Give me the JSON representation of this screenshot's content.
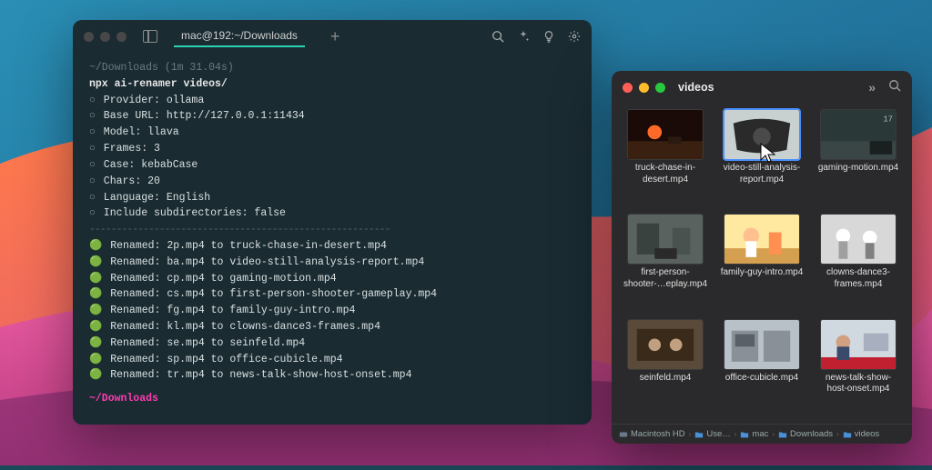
{
  "terminal": {
    "tab_title": "mac@192:~/Downloads",
    "prompt_path": "~/Downloads",
    "prompt_timing": "(1m 31.04s)",
    "command": "npx ai-renamer videos/",
    "config": [
      {
        "label": "Provider",
        "value": "ollama"
      },
      {
        "label": "Base URL",
        "value": "http://127.0.0.1:11434"
      },
      {
        "label": "Model",
        "value": "llava"
      },
      {
        "label": "Frames",
        "value": "3"
      },
      {
        "label": "Case",
        "value": "kebabCase"
      },
      {
        "label": "Chars",
        "value": "20"
      },
      {
        "label": "Language",
        "value": "English"
      },
      {
        "label": "Include subdirectories",
        "value": "false"
      }
    ],
    "renames": [
      {
        "from": "2p.mp4",
        "to": "truck-chase-in-desert.mp4"
      },
      {
        "from": "ba.mp4",
        "to": "video-still-analysis-report.mp4"
      },
      {
        "from": "cp.mp4",
        "to": "gaming-motion.mp4"
      },
      {
        "from": "cs.mp4",
        "to": "first-person-shooter-gameplay.mp4"
      },
      {
        "from": "fg.mp4",
        "to": "family-guy-intro.mp4"
      },
      {
        "from": "kl.mp4",
        "to": "clowns-dance3-frames.mp4"
      },
      {
        "from": "se.mp4",
        "to": "seinfeld.mp4"
      },
      {
        "from": "sp.mp4",
        "to": "office-cubicle.mp4"
      },
      {
        "from": "tr.mp4",
        "to": "news-talk-show-host-onset.mp4"
      }
    ],
    "final_prompt": "~/Downloads"
  },
  "finder": {
    "title": "videos",
    "files": [
      {
        "name": "truck-chase-in-desert.mp4",
        "art": "desert"
      },
      {
        "name": "video-still-analysis-report.mp4",
        "art": "vehicle",
        "selected": true
      },
      {
        "name": "gaming-motion.mp4",
        "art": "fps1"
      },
      {
        "name": "first-person-shooter-…eplay.mp4",
        "art": "fps2"
      },
      {
        "name": "family-guy-intro.mp4",
        "art": "cartoon"
      },
      {
        "name": "clowns-dance3-frames.mp4",
        "art": "clowns"
      },
      {
        "name": "seinfeld.mp4",
        "art": "sitcom"
      },
      {
        "name": "office-cubicle.mp4",
        "art": "office"
      },
      {
        "name": "news-talk-show-host-onset.mp4",
        "art": "news"
      }
    ],
    "path": [
      {
        "icon": "disk",
        "label": "Macintosh HD"
      },
      {
        "icon": "folder",
        "label": "Use…"
      },
      {
        "icon": "folder",
        "label": "mac"
      },
      {
        "icon": "folder",
        "label": "Downloads"
      },
      {
        "icon": "folder",
        "label": "videos"
      }
    ]
  }
}
